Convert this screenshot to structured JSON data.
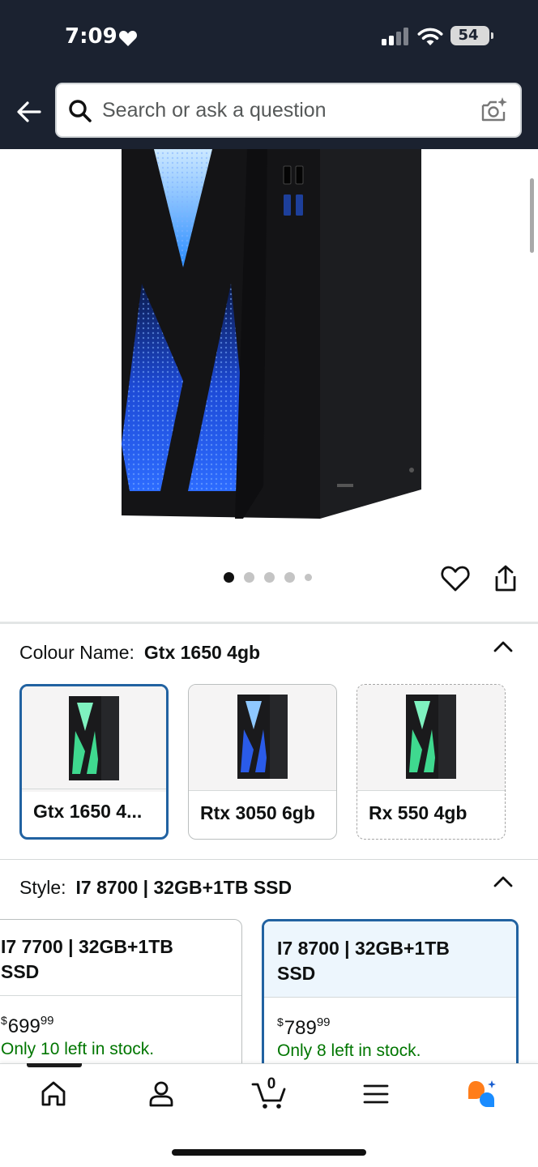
{
  "status_bar": {
    "time": "7:09",
    "battery": "54",
    "icons": [
      "heart-icon",
      "cellular-signal-icon",
      "wifi-icon",
      "battery-icon"
    ]
  },
  "header": {
    "search_placeholder": "Search or ask a question",
    "icons": [
      "back-arrow-icon",
      "search-icon",
      "camera-search-icon"
    ]
  },
  "gallery": {
    "image_count": 5,
    "active_index": 0,
    "icons": [
      "heart-outline-icon",
      "share-icon"
    ]
  },
  "colour": {
    "label": "Colour Name:",
    "selected": "Gtx 1650 4gb",
    "options": [
      {
        "label": "Gtx 1650 4...",
        "selected": true
      },
      {
        "label": "Rtx 3050 6gb",
        "selected": false
      },
      {
        "label": "Rx 550 4gb",
        "selected": false
      }
    ]
  },
  "style": {
    "label": "Style:",
    "selected": "I7 8700 | 32GB+1TB SSD",
    "options": [
      {
        "line1": "I7 7700 | 32GB+1TB",
        "line2": "SSD",
        "price_symbol": "$",
        "price_whole": "699",
        "price_fraction": "99",
        "stock": "Only 10 left in stock.",
        "selected": false
      },
      {
        "line1": "I7 8700 | 32GB+1TB",
        "line2": "SSD",
        "price_symbol": "$",
        "price_whole": "789",
        "price_fraction": "99",
        "stock": "Only 8 left in stock.",
        "selected": true
      }
    ]
  },
  "bottom_nav": {
    "cart_count": "0",
    "items": [
      "home-icon",
      "account-icon",
      "cart-icon",
      "menu-icon",
      "rufus-assistant-icon"
    ]
  },
  "colors": {
    "header_bg": "#1b2230",
    "selected_border": "#2162a1",
    "in_stock": "#007600"
  }
}
